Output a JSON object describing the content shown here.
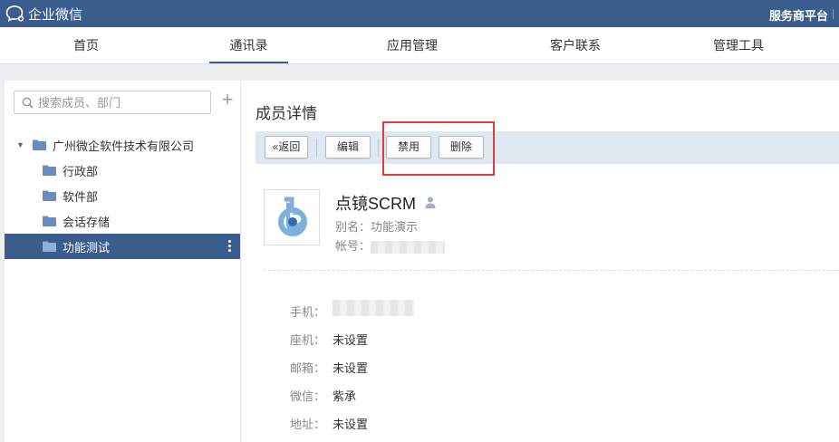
{
  "app": {
    "title": "企业微信",
    "service_platform": "服务商平台"
  },
  "nav": {
    "tabs": [
      {
        "label": "首页"
      },
      {
        "label": "通讯录",
        "active": true
      },
      {
        "label": "应用管理"
      },
      {
        "label": "客户联系"
      },
      {
        "label": "管理工具"
      }
    ]
  },
  "sidebar": {
    "search_placeholder": "搜索成员、部门",
    "tree": {
      "root": "广州微企软件技术有限公司",
      "departments": [
        {
          "label": "行政部"
        },
        {
          "label": "软件部"
        },
        {
          "label": "会话存储"
        },
        {
          "label": "功能测试",
          "selected": true
        }
      ]
    }
  },
  "detail": {
    "page_title": "成员详情",
    "toolbar": {
      "back": "返回",
      "edit": "编辑",
      "disable": "禁用",
      "delete": "删除"
    },
    "member": {
      "name": "点镜SCRM",
      "alias_label": "别名：",
      "alias": "功能演示",
      "account_label": "帐号："
    },
    "fields": [
      {
        "label": "手机：",
        "value": ""
      },
      {
        "label": "座机：",
        "value": "未设置"
      },
      {
        "label": "邮箱：",
        "value": "未设置"
      },
      {
        "label": "微信：",
        "value": "紫承"
      },
      {
        "label": "地址：",
        "value": "未设置"
      }
    ]
  },
  "colors": {
    "brand": "#3b5d8e",
    "highlight": "#e33a3a",
    "toolbar_bg": "#dfe7f1"
  }
}
